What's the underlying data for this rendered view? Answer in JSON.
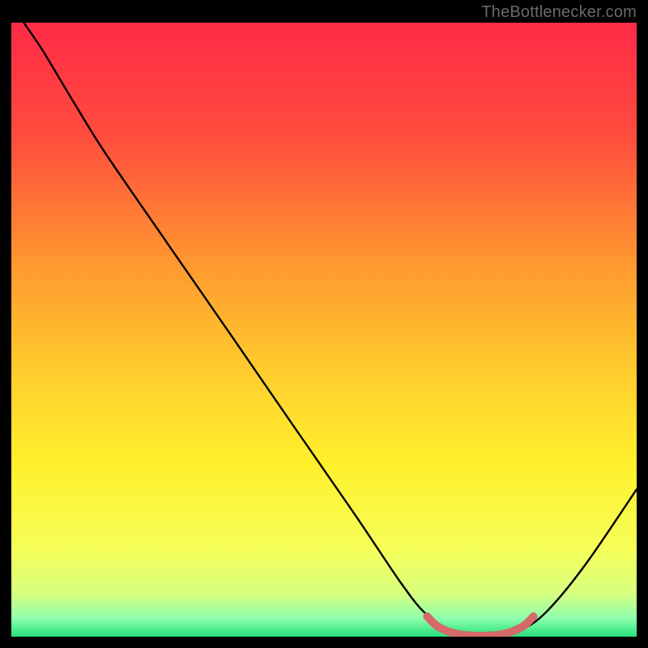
{
  "watermark": "TheBottlenecker.com",
  "chart_data": {
    "type": "line",
    "title": "",
    "xlabel": "",
    "ylabel": "",
    "xlim": [
      0,
      100
    ],
    "ylim": [
      0,
      100
    ],
    "gradient_stops": [
      {
        "offset": 0,
        "color": "#ff2b47"
      },
      {
        "offset": 18,
        "color": "#ff4b3e"
      },
      {
        "offset": 40,
        "color": "#ff9a2f"
      },
      {
        "offset": 58,
        "color": "#ffd02e"
      },
      {
        "offset": 72,
        "color": "#fff02c"
      },
      {
        "offset": 86,
        "color": "#f6ff5a"
      },
      {
        "offset": 93,
        "color": "#d6ff7e"
      },
      {
        "offset": 97,
        "color": "#8fffad"
      },
      {
        "offset": 100,
        "color": "#26e07a"
      }
    ],
    "series": [
      {
        "name": "bottleneck-curve",
        "color": "#000000",
        "points": [
          {
            "x": 2.0,
            "y": 100.0
          },
          {
            "x": 5.0,
            "y": 95.5
          },
          {
            "x": 10.0,
            "y": 87.0
          },
          {
            "x": 15.0,
            "y": 78.8
          },
          {
            "x": 25.0,
            "y": 64.0
          },
          {
            "x": 35.0,
            "y": 49.3
          },
          {
            "x": 45.0,
            "y": 34.5
          },
          {
            "x": 55.0,
            "y": 19.8
          },
          {
            "x": 62.0,
            "y": 9.2
          },
          {
            "x": 66.0,
            "y": 4.0
          },
          {
            "x": 70.0,
            "y": 1.2
          },
          {
            "x": 74.0,
            "y": 0.2
          },
          {
            "x": 78.0,
            "y": 0.2
          },
          {
            "x": 82.0,
            "y": 1.3
          },
          {
            "x": 86.0,
            "y": 4.5
          },
          {
            "x": 92.0,
            "y": 12.0
          },
          {
            "x": 100.0,
            "y": 24.0
          }
        ]
      },
      {
        "name": "optimal-region",
        "color": "#d46a6a",
        "points": [
          {
            "x": 66.5,
            "y": 3.3
          },
          {
            "x": 68.0,
            "y": 1.8
          },
          {
            "x": 70.0,
            "y": 0.8
          },
          {
            "x": 72.0,
            "y": 0.3
          },
          {
            "x": 74.0,
            "y": 0.15
          },
          {
            "x": 76.0,
            "y": 0.15
          },
          {
            "x": 78.0,
            "y": 0.3
          },
          {
            "x": 80.0,
            "y": 0.8
          },
          {
            "x": 82.0,
            "y": 1.8
          },
          {
            "x": 83.5,
            "y": 3.3
          }
        ]
      }
    ]
  }
}
